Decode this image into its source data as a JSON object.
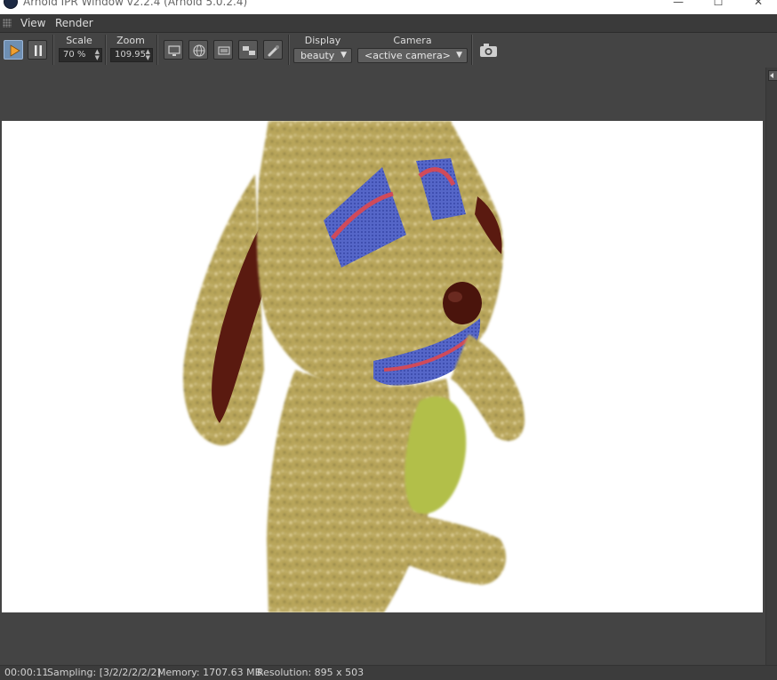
{
  "window": {
    "title": "Arnold IPR Window v2.2.4 (Arnold 5.0.2.4)",
    "controls": [
      "—",
      "☐",
      "✕"
    ]
  },
  "menubar": {
    "items": [
      "View",
      "Render"
    ]
  },
  "toolbar": {
    "scale_label": "Scale",
    "scale_value": "70 %",
    "zoom_label": "Zoom",
    "zoom_value": "109.95",
    "display_label": "Display",
    "display_value": "beauty",
    "camera_label": "Camera",
    "camera_value": "<active camera>",
    "accent": "#6e8fb3"
  },
  "status": {
    "time": "00:00:11",
    "sampling": "Sampling: [3/2/2/2/2/2]",
    "memory": "Memory: 1707.63 MB",
    "resolution": "Resolution: 895 x 503"
  },
  "render": {
    "background": "#ffffff",
    "fur_color": "#b8a55a",
    "ear_color": "#5a1a10",
    "patch_blue": "#5566c8",
    "patch_red": "#d04a5a",
    "belly_color": "#b2bf4a"
  }
}
